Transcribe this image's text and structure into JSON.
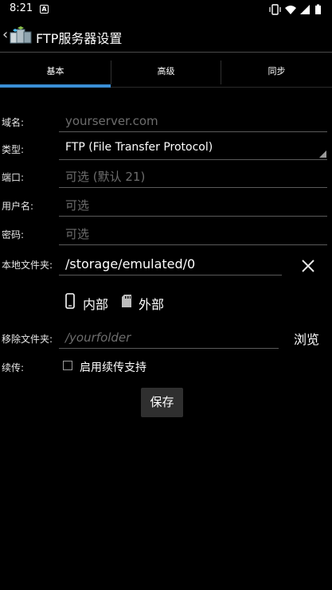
{
  "status_bar": {
    "time": "8:21",
    "notification_icon": "a-letter-icon",
    "icons": [
      "vibrate-icon",
      "wifi-icon",
      "cell-signal-icon",
      "battery-icon"
    ]
  },
  "app": {
    "title": "FTP服务器设置",
    "back_icon": "chevron-left-icon",
    "app_icon": "ftp-app-icon"
  },
  "tabs": [
    {
      "label": "基本",
      "selected": true
    },
    {
      "label": "高级",
      "selected": false
    },
    {
      "label": "同步",
      "selected": false
    }
  ],
  "form": {
    "domain": {
      "label": "域名:",
      "placeholder": "yourserver.com"
    },
    "type": {
      "label": "类型:",
      "value": "FTP (File Transfer Protocol)"
    },
    "port": {
      "label": "端口:",
      "placeholder": "可选 (默认 21)"
    },
    "username": {
      "label": "用户名:",
      "placeholder": "可选"
    },
    "password": {
      "label": "密码:",
      "placeholder": "可选"
    },
    "local_folder": {
      "label": "本地文件夹:",
      "value": "/storage/emulated/0"
    },
    "storage": {
      "internal": "内部",
      "external": "外部"
    },
    "remote_folder": {
      "label": "移除文件夹:",
      "placeholder": "/yourfolder",
      "browse": "浏览"
    },
    "resume": {
      "label": "续传:",
      "checkbox_label": "启用续传支持",
      "checked": false
    },
    "save": "保存"
  },
  "colors": {
    "accent": "#3a8fd6",
    "background": "#000000",
    "placeholder": "#6d6d6d"
  }
}
